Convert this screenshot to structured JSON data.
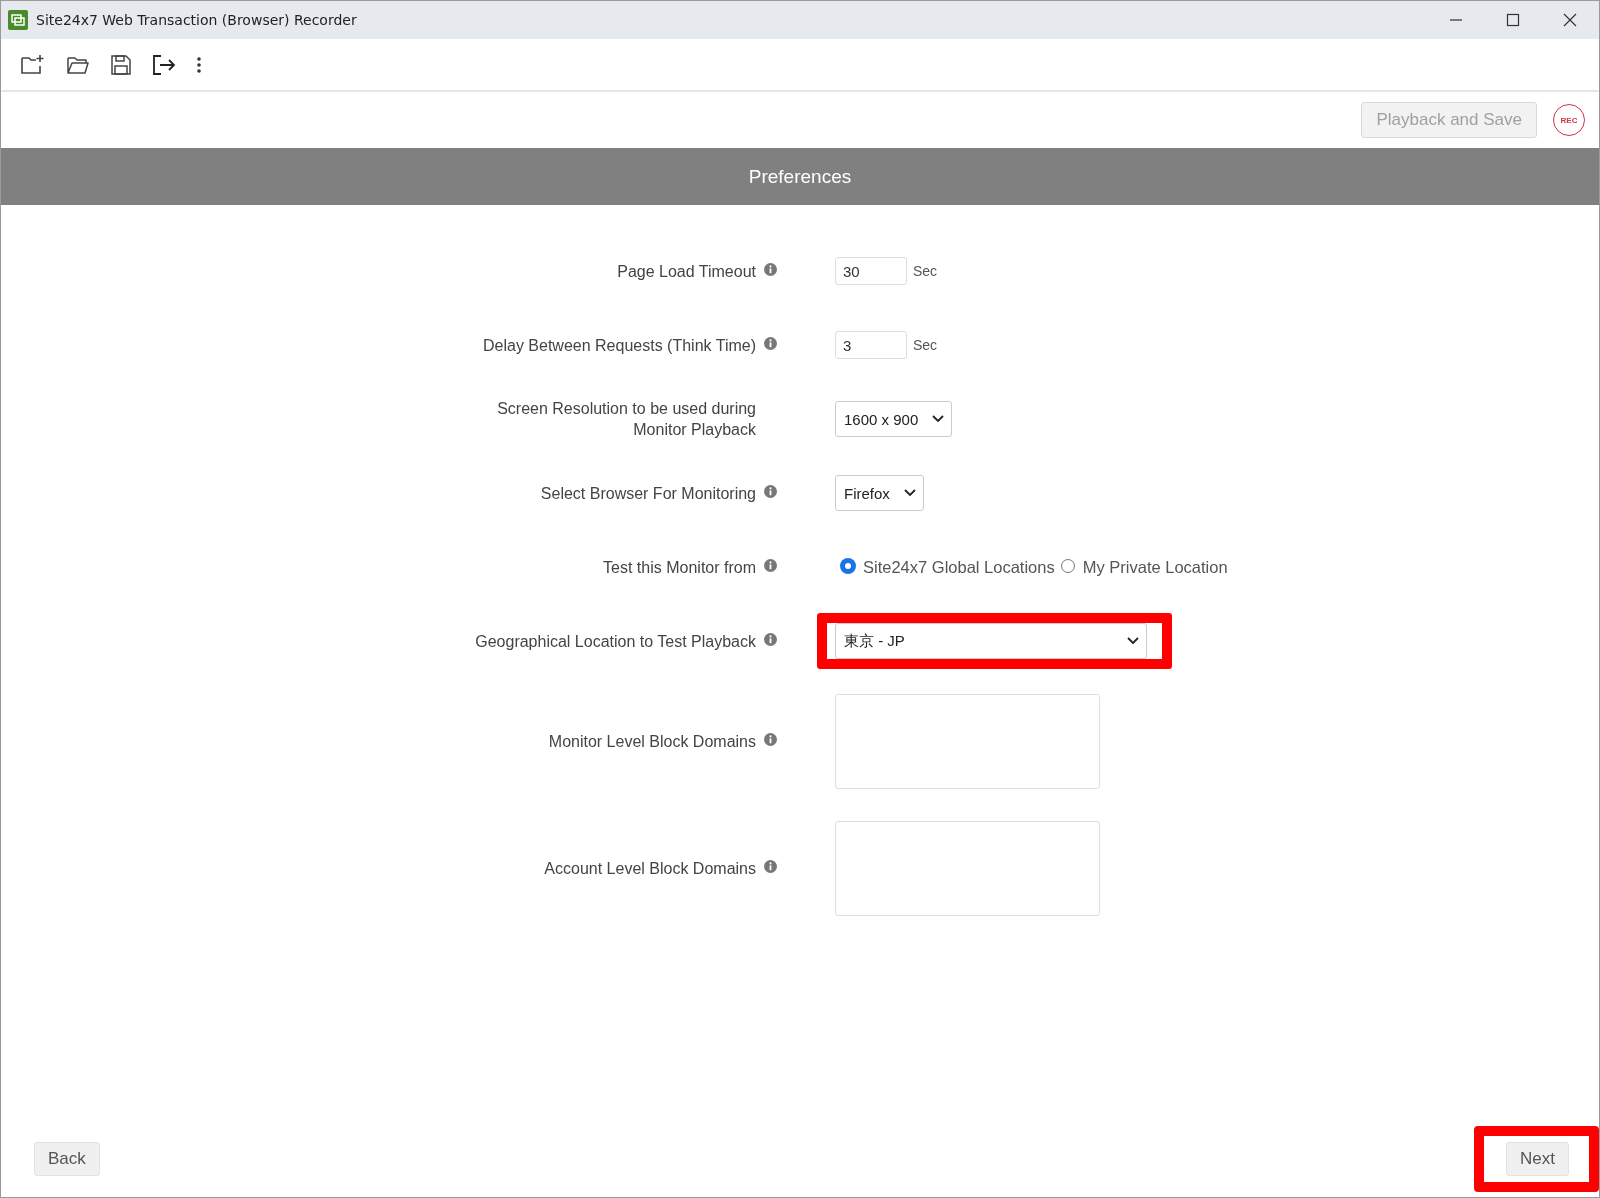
{
  "window": {
    "title": "Site24x7 Web Transaction (Browser) Recorder"
  },
  "action_bar": {
    "playback_button": {
      "label": "Playback and Save",
      "disabled": true
    },
    "rec_button": {
      "label": "REC"
    }
  },
  "header": {
    "title": "Preferences"
  },
  "fields": [
    {
      "kind": "number",
      "label": "Page Load Timeout",
      "info": true,
      "value": "30",
      "unit": "Sec",
      "highlighted": false
    },
    {
      "kind": "number",
      "label": "Delay Between Requests (Think Time)",
      "info": true,
      "value": "3",
      "unit": "Sec",
      "highlighted": false
    },
    {
      "kind": "select",
      "label": "Screen Resolution to be used during Monitor Playback",
      "info": false,
      "value": "1600 x 900",
      "highlighted": false
    },
    {
      "kind": "select",
      "label": "Select Browser For Monitoring",
      "info": true,
      "value": "Firefox",
      "highlighted": false
    },
    {
      "kind": "radio",
      "label": "Test this Monitor from",
      "info": true,
      "options": [
        {
          "label": "Site24x7 Global Locations",
          "selected": true
        },
        {
          "label": "My Private Location",
          "selected": false
        }
      ],
      "highlighted": false
    },
    {
      "kind": "wide-select",
      "label": "Geographical Location to Test Playback",
      "info": true,
      "value": "東京 - JP",
      "highlighted": true
    },
    {
      "kind": "textarea",
      "label": "Monitor Level Block Domains",
      "info": true,
      "highlighted": false
    },
    {
      "kind": "textarea",
      "label": "Account Level Block Domains",
      "info": true,
      "highlighted": false
    }
  ],
  "footer": {
    "back_button": {
      "label": "Back",
      "highlighted": false
    },
    "next_button": {
      "label": "Next",
      "highlighted": true
    }
  }
}
